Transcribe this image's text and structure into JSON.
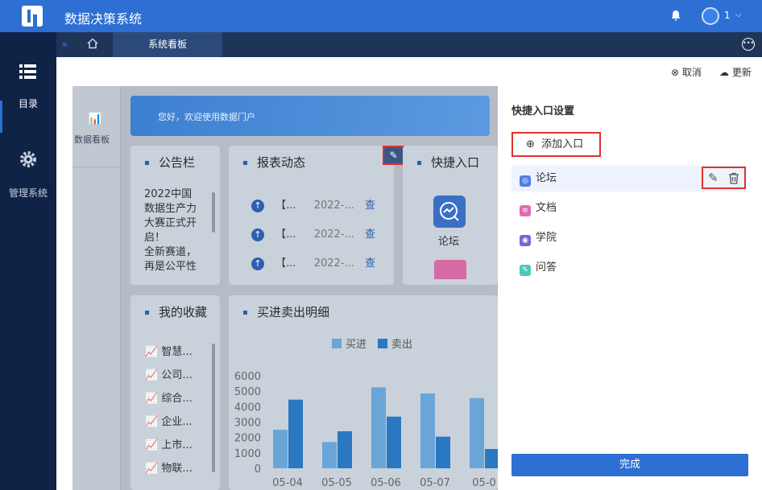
{
  "app": {
    "title": "数据决策系统",
    "user_number": "1"
  },
  "left_nav": [
    {
      "label": "目录",
      "icon": "list-icon",
      "active": true
    },
    {
      "label": "管理系统",
      "icon": "gear-icon",
      "active": false
    }
  ],
  "tabs": {
    "active": "系统看板"
  },
  "toolbar": {
    "cancel": "取消",
    "refresh": "更新"
  },
  "dashboard": {
    "sidebar_label": "数据看板",
    "banner_text": "您好，欢迎使用数据门户",
    "announcement": {
      "title": "公告栏",
      "lines": [
        "2022中国",
        "数据生产力",
        "大赛正式开",
        "启！",
        "全新赛道，",
        "再是公平性"
      ]
    },
    "report_feed": {
      "title": "报表动态",
      "rows": [
        {
          "name": "【...",
          "date": "2022-...",
          "action": "查"
        },
        {
          "name": "【...",
          "date": "2022-...",
          "action": "查"
        },
        {
          "name": "【...",
          "date": "2022-...",
          "action": "查"
        }
      ]
    },
    "quick_entry": {
      "title": "快捷入口",
      "item": "论坛"
    },
    "favorites": {
      "title": "我的收藏",
      "items": [
        "智慧...",
        "公司...",
        "综合...",
        "企业...",
        "上市...",
        "物联..."
      ]
    },
    "trade_detail": {
      "title": "买进卖出明细"
    }
  },
  "chart_data": {
    "type": "bar",
    "categories": [
      "05-04",
      "05-05",
      "05-06",
      "05-07",
      "05-0"
    ],
    "series": [
      {
        "name": "买进",
        "values": [
          2500,
          1700,
          5250,
          4850,
          4550
        ]
      },
      {
        "name": "卖出",
        "values": [
          4450,
          2400,
          3350,
          2050,
          1250
        ]
      }
    ],
    "ylim": [
      0,
      6000
    ],
    "yticks": [
      "6000",
      "5000",
      "4000",
      "3000",
      "2000",
      "1000",
      "0"
    ],
    "legend_position": "top"
  },
  "panel": {
    "title": "快捷入口设置",
    "add_button": "添加入口",
    "entries": [
      {
        "label": "论坛",
        "color": "#4f7fe8",
        "selected": true
      },
      {
        "label": "文档",
        "color": "#e06bb5",
        "selected": false
      },
      {
        "label": "学院",
        "color": "#7a63d6",
        "selected": false
      },
      {
        "label": "问答",
        "color": "#4cc9b6",
        "selected": false
      }
    ],
    "done_button": "完成"
  },
  "colors": {
    "brand": "#2d6fd2",
    "nav_bg": "#0f2347",
    "highlight": "#e0322d"
  }
}
